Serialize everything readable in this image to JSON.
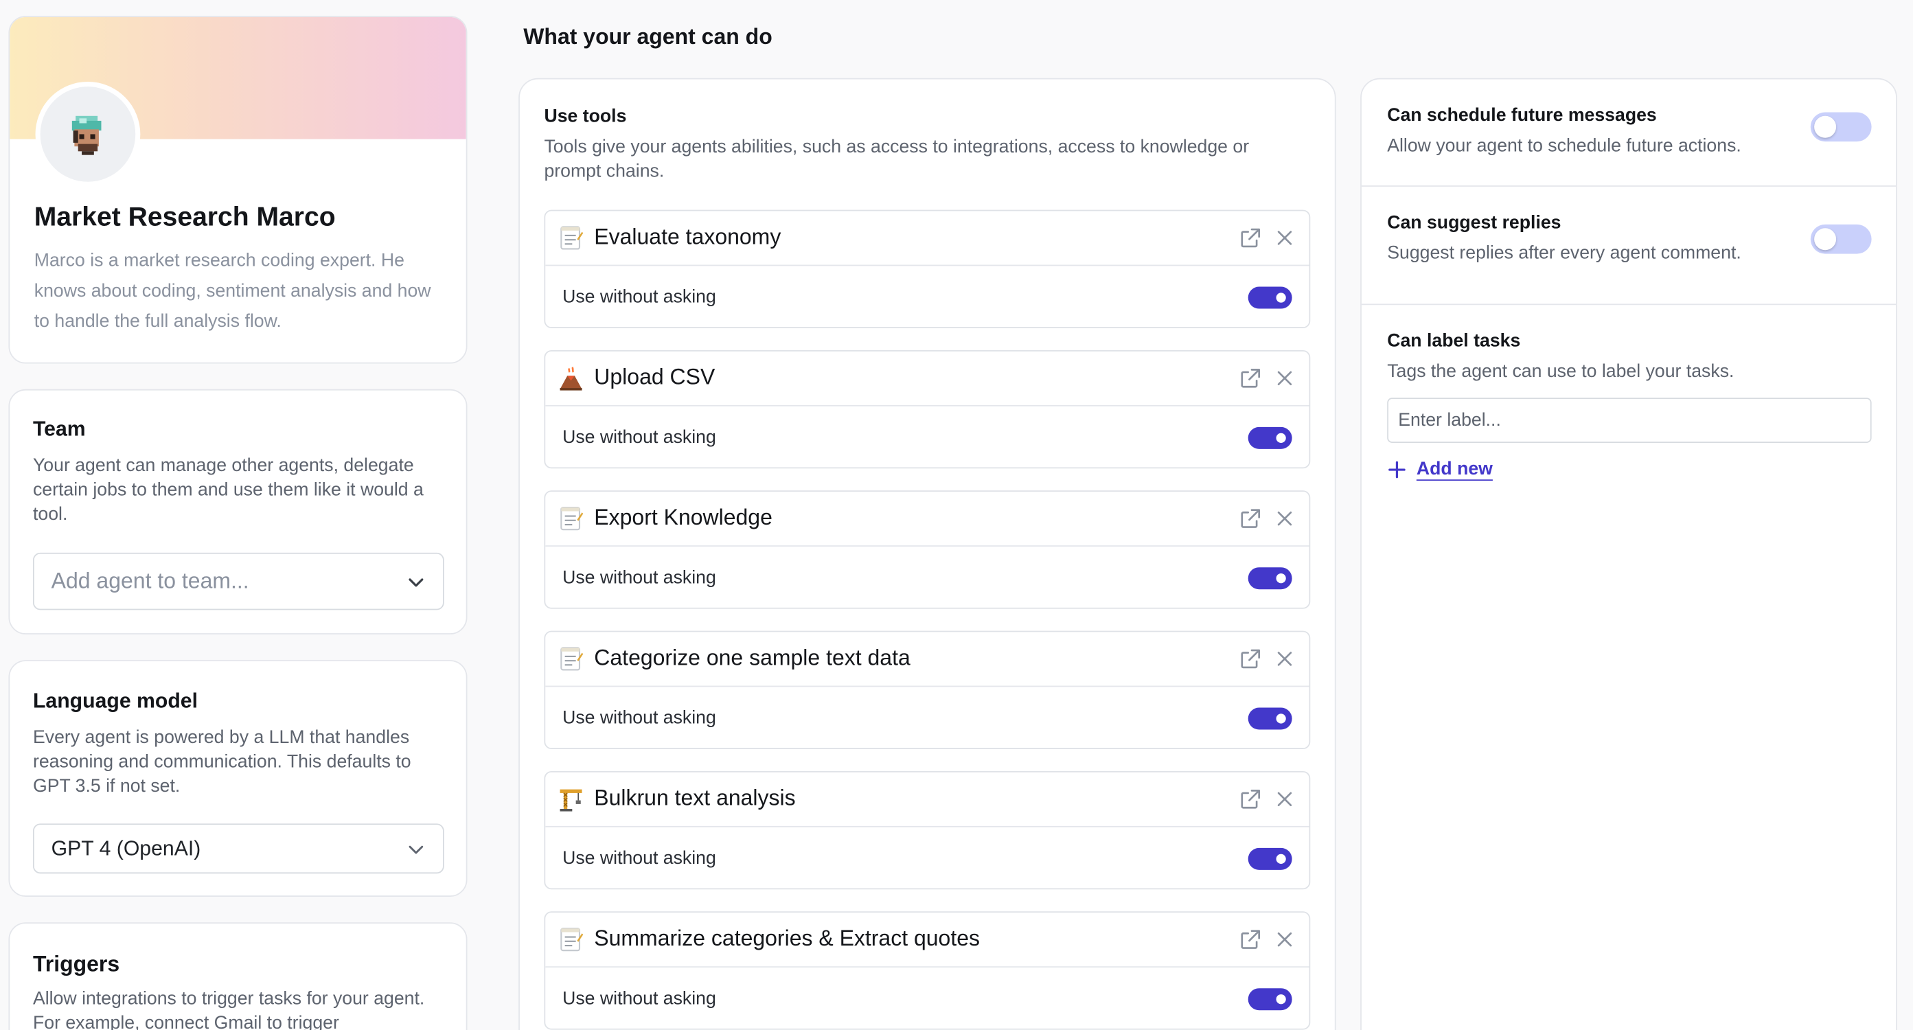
{
  "agent": {
    "name": "Market Research Marco",
    "description": "Marco is a market research coding expert. He knows about coding, sentiment analysis and how to handle the full analysis flow."
  },
  "team": {
    "title": "Team",
    "description": "Your agent can manage other agents, delegate certain jobs to them and use them like it would a tool.",
    "placeholder": "Add agent to team..."
  },
  "language_model": {
    "title": "Language model",
    "description": "Every agent is powered by a LLM that handles reasoning and communication. This defaults to GPT 3.5 if not set.",
    "selected": "GPT 4 (OpenAI)"
  },
  "triggers": {
    "title": "Triggers",
    "description": "Allow integrations to trigger tasks for your agent. For example, connect Gmail to trigger"
  },
  "main": {
    "title": "What your agent can do"
  },
  "tools": {
    "title": "Use tools",
    "description": "Tools give your agents abilities, such as access to integrations, access to knowledge or prompt chains.",
    "items": [
      {
        "name": "Evaluate taxonomy",
        "icon": "memo-icon",
        "option": "Use without asking",
        "enabled": true
      },
      {
        "name": "Upload CSV",
        "icon": "volcano-icon",
        "option": "Use without asking",
        "enabled": true
      },
      {
        "name": "Export Knowledge",
        "icon": "memo-icon",
        "option": "Use without asking",
        "enabled": true
      },
      {
        "name": "Categorize one sample text data",
        "icon": "memo-icon",
        "option": "Use without asking",
        "enabled": true
      },
      {
        "name": "Bulkrun text analysis",
        "icon": "crane-icon",
        "option": "Use without asking",
        "enabled": true
      },
      {
        "name": "Summarize categories & Extract quotes",
        "icon": "memo-icon",
        "option": "Use without asking",
        "enabled": true
      }
    ]
  },
  "capabilities": {
    "schedule": {
      "title": "Can schedule future messages",
      "description": "Allow your agent to schedule future actions.",
      "enabled": false
    },
    "suggest": {
      "title": "Can suggest replies",
      "description": "Suggest replies after every agent comment.",
      "enabled": false
    },
    "labels": {
      "title": "Can label tasks",
      "description": "Tags the agent can use to label your tasks.",
      "placeholder": "Enter label...",
      "add_label": "Add new"
    }
  },
  "colors": {
    "accent": "#4338ca",
    "toggle_off": "#c9d0fb",
    "muted_text": "#8a919e"
  }
}
